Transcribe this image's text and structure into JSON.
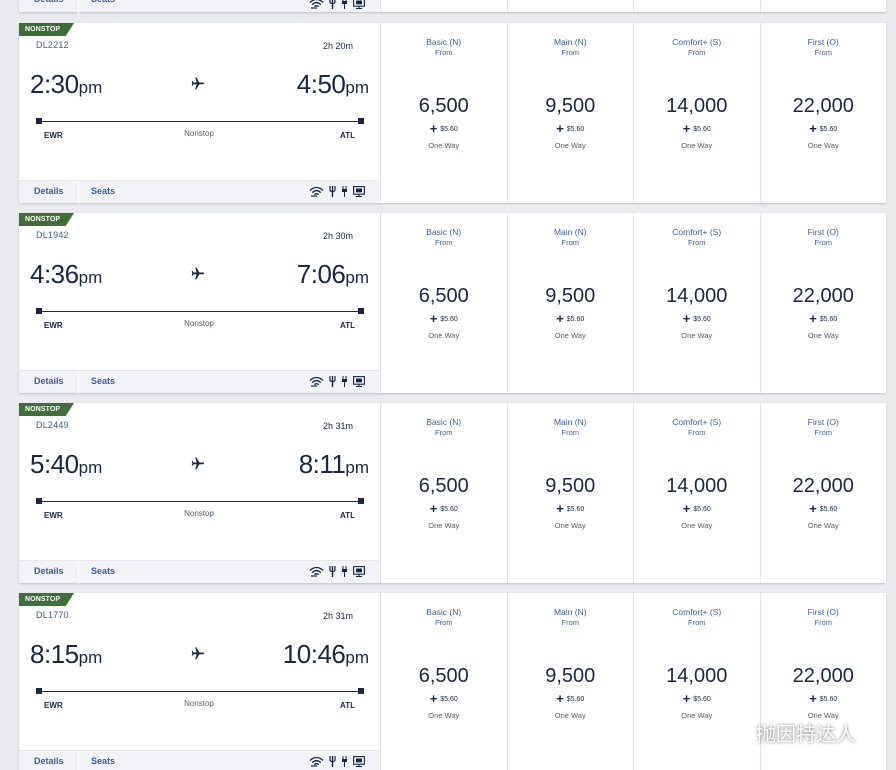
{
  "labels": {
    "badge": "NONSTOP",
    "details": "Details",
    "seats": "Seats",
    "stops": "Nonstop",
    "from": "From",
    "one_way": "One Way",
    "origin": "EWR",
    "destination": "ATL"
  },
  "cabins": [
    "Basic (N)",
    "Main (N)",
    "Comfort+ (S)",
    "First (O)"
  ],
  "flights": [
    {
      "number": "DL2212",
      "duration": "2h 20m",
      "dep": "2:30",
      "dep_ampm": "pm",
      "arr": "4:50",
      "arr_ampm": "pm",
      "fares": [
        {
          "miles": "6,500",
          "fee": "$5.60"
        },
        {
          "miles": "9,500",
          "fee": "$5.60"
        },
        {
          "miles": "14,000",
          "fee": "$5.60"
        },
        {
          "miles": "22,000",
          "fee": "$5.60"
        }
      ]
    },
    {
      "number": "DL1942",
      "duration": "2h 30m",
      "dep": "4:36",
      "dep_ampm": "pm",
      "arr": "7:06",
      "arr_ampm": "pm",
      "fares": [
        {
          "miles": "6,500",
          "fee": "$5.60"
        },
        {
          "miles": "9,500",
          "fee": "$5.60"
        },
        {
          "miles": "14,000",
          "fee": "$5.60"
        },
        {
          "miles": "22,000",
          "fee": "$5.60"
        }
      ]
    },
    {
      "number": "DL2449",
      "duration": "2h 31m",
      "dep": "5:40",
      "dep_ampm": "pm",
      "arr": "8:11",
      "arr_ampm": "pm",
      "fares": [
        {
          "miles": "6,500",
          "fee": "$5.60"
        },
        {
          "miles": "9,500",
          "fee": "$5.60"
        },
        {
          "miles": "14,000",
          "fee": "$5.60"
        },
        {
          "miles": "22,000",
          "fee": "$5.60"
        }
      ]
    },
    {
      "number": "DL1770",
      "duration": "2h 31m",
      "dep": "8:15",
      "dep_ampm": "pm",
      "arr": "10:46",
      "arr_ampm": "pm",
      "fares": [
        {
          "miles": "6,500",
          "fee": "$5.60"
        },
        {
          "miles": "9,500",
          "fee": "$5.60"
        },
        {
          "miles": "14,000",
          "fee": "$5.60"
        },
        {
          "miles": "22,000",
          "fee": "$5.60"
        }
      ]
    }
  ],
  "amenity_icons": [
    "wifi-icon",
    "food-icon",
    "power-icon",
    "entertainment-icon"
  ],
  "watermark": "抛因特达人",
  "colors": {
    "badge": "#3f6e3a",
    "link": "#3b5f9e",
    "text": "#1a2741",
    "background": "#e9ebef"
  }
}
